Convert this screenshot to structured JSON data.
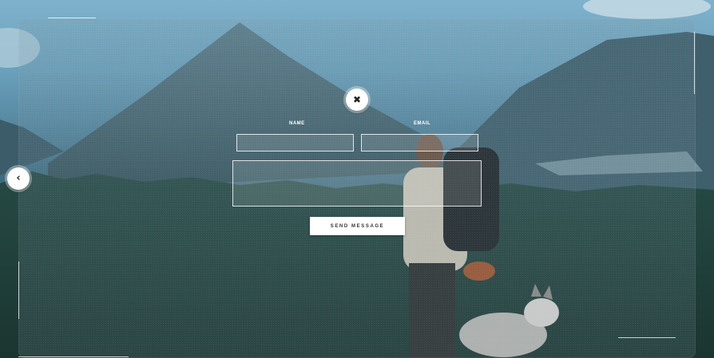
{
  "form": {
    "name_label": "NAME",
    "email_label": "EMAIL",
    "name_value": "",
    "email_value": "",
    "message_value": "",
    "send_label": "SEND MESSAGE"
  },
  "controls": {
    "close_icon": "close-icon",
    "close_glyph": "✖",
    "back_icon": "chevron-left-icon",
    "back_glyph": "‹"
  },
  "colors": {
    "overlay_tint": "#78969f",
    "button_bg": "#ffffff",
    "label_color": "#ffffff"
  }
}
